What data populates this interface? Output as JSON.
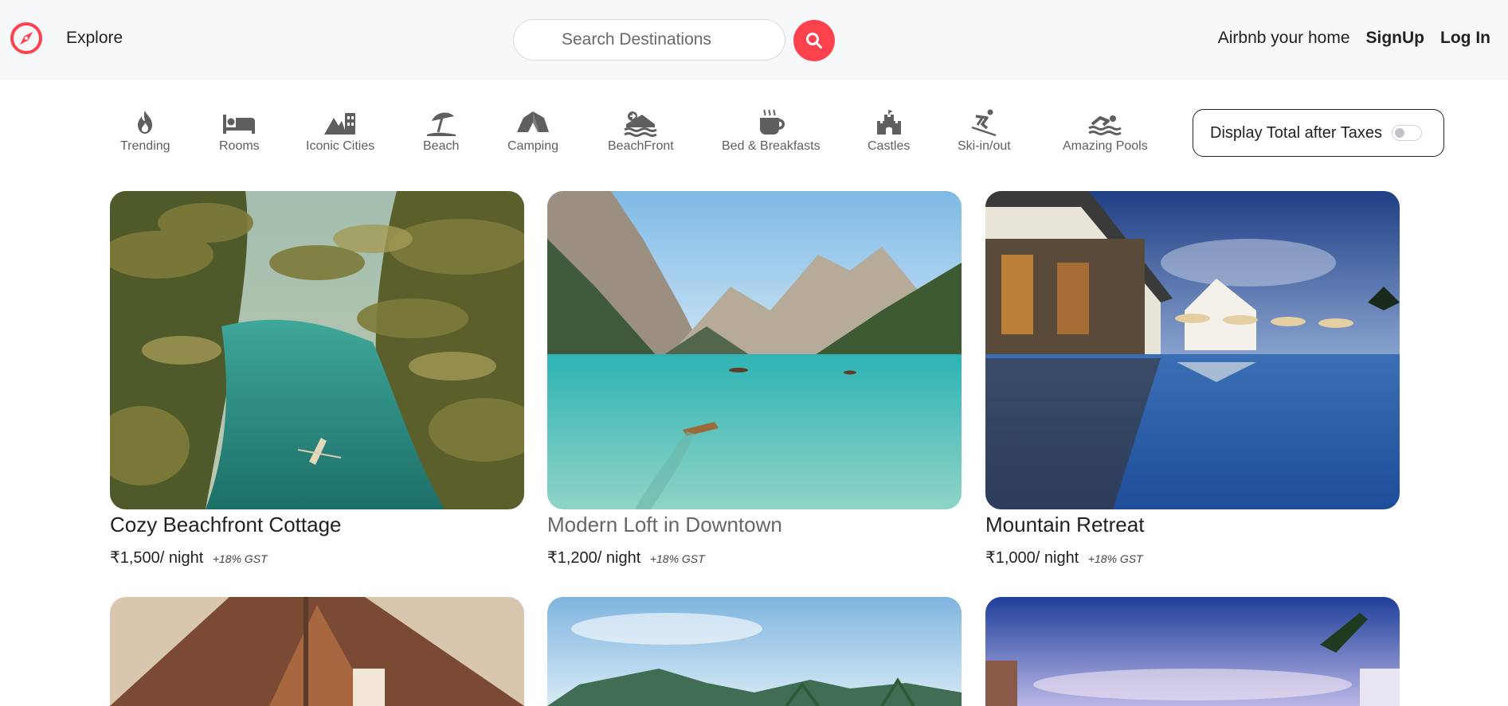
{
  "header": {
    "logo_icon": "compass-icon",
    "explore_label": "Explore",
    "search_placeholder": "Search Destinations",
    "search_icon": "search-icon",
    "host_link": "Airbnb your home",
    "signup_link": "SignUp",
    "login_link": "Log In",
    "accent_color": "#fe424d"
  },
  "filters": {
    "items": [
      {
        "label": "Trending",
        "icon": "fire-icon"
      },
      {
        "label": "Rooms",
        "icon": "bed-icon"
      },
      {
        "label": "Iconic Cities",
        "icon": "city-icon"
      },
      {
        "label": "Beach",
        "icon": "umbrella-beach-icon"
      },
      {
        "label": "Camping",
        "icon": "tent-icon"
      },
      {
        "label": "BeachFront",
        "icon": "water-wave-icon"
      },
      {
        "label": "Bed & Breakfasts",
        "icon": "coffee-mug-icon"
      },
      {
        "label": "Castles",
        "icon": "castle-icon"
      },
      {
        "label": "Ski-in/out",
        "icon": "skiing-icon"
      },
      {
        "label": "Amazing Pools",
        "icon": "swimmer-icon"
      }
    ],
    "tax_toggle": {
      "label": "Display Total after Taxes",
      "checked": false
    }
  },
  "listings": [
    {
      "title": "Cozy Beachfront Cottage",
      "price": "₹1,500/ night",
      "tax": "+18% GST",
      "image": "tropical-river-palms"
    },
    {
      "title": "Modern Loft in Downtown",
      "price": "₹1,200/ night",
      "tax": "+18% GST",
      "image": "mountain-lake-boat"
    },
    {
      "title": "Mountain Retreat",
      "price": "₹1,000/ night",
      "tax": "+18% GST",
      "image": "resort-pool-night"
    },
    {
      "title": "",
      "price": "",
      "tax": "",
      "image": "wooden-cabin"
    },
    {
      "title": "",
      "price": "",
      "tax": "",
      "image": "tropical-cliffs"
    },
    {
      "title": "",
      "price": "",
      "tax": "",
      "image": "beach-sunset-palms"
    }
  ]
}
